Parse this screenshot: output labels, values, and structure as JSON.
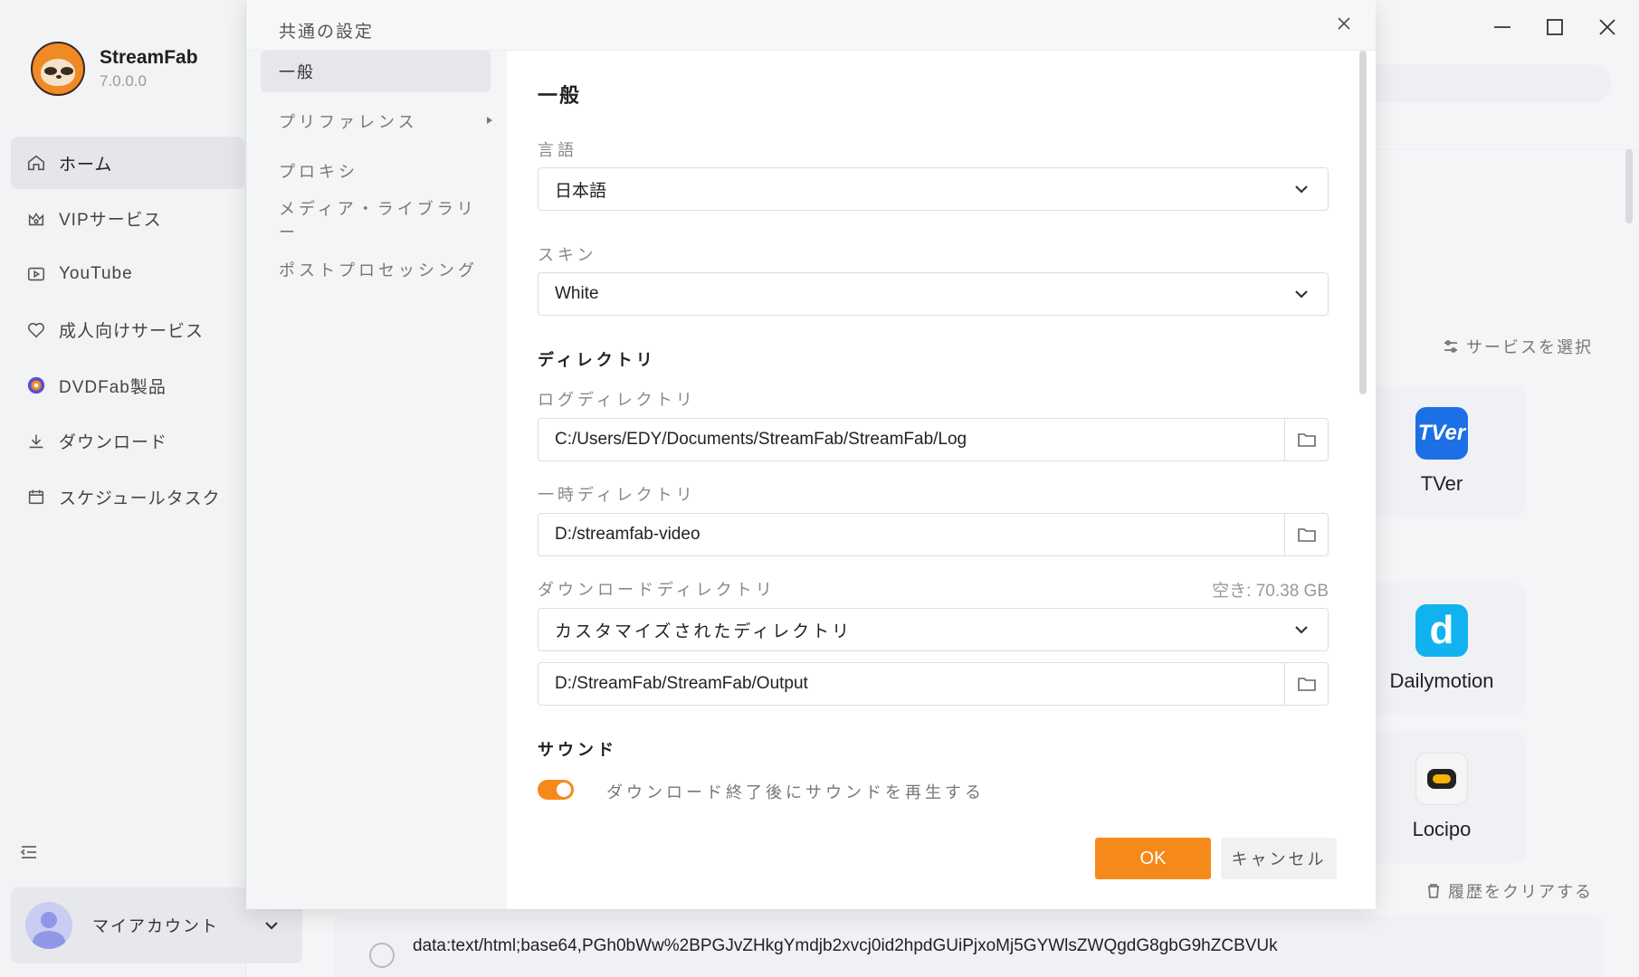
{
  "app": {
    "name": "StreamFab",
    "version": "7.0.0.0"
  },
  "sidebar": {
    "items": [
      {
        "label": "ホーム",
        "icon": "home-icon",
        "active": true
      },
      {
        "label": "VIPサービス",
        "icon": "vip-icon"
      },
      {
        "label": "YouTube",
        "icon": "youtube-icon"
      },
      {
        "label": "成人向けサービス",
        "icon": "heart-icon"
      },
      {
        "label": "DVDFab製品",
        "icon": "dvdfab-icon"
      },
      {
        "label": "ダウンロード",
        "icon": "download-icon"
      },
      {
        "label": "スケジュールタスク",
        "icon": "calendar-icon"
      }
    ],
    "account_label": "マイアカウント"
  },
  "main": {
    "select_service": "サービスを選択",
    "services": [
      {
        "name": "TVer",
        "color": "#1d6fe5"
      },
      {
        "name": "Dailymotion",
        "color": "#10b3f0"
      },
      {
        "name": "Locipo",
        "color": "#f5f5f5"
      }
    ],
    "clear_history": "履歴をクリアする",
    "url_text": "data:text/html;base64,PGh0bWw%2BPGJvZHkgYmdjb2xvcj0id2hpdGUiPjxoMj5GYWlsZWQgdG8gbG9hZCBVUk"
  },
  "dialog": {
    "title": "共通の設定",
    "nav": [
      {
        "label": "一般",
        "active": true
      },
      {
        "label": "プリファレンス",
        "has_submenu": true
      },
      {
        "label": "プロキシ"
      },
      {
        "label": "メディア・ライブラリー"
      },
      {
        "label": "ポストプロセッシング"
      }
    ],
    "section_title": "一般",
    "language": {
      "label": "言語",
      "value": "日本語"
    },
    "skin": {
      "label": "スキン",
      "value": "White"
    },
    "directory_heading": "ディレクトリ",
    "log_dir": {
      "label": "ログディレクトリ",
      "value": "C:/Users/EDY/Documents/StreamFab/StreamFab/Log"
    },
    "temp_dir": {
      "label": "一時ディレクトリ",
      "value": "D:/streamfab-video"
    },
    "download_dir": {
      "label": "ダウンロードディレクトリ",
      "free_space": "空き: 70.38 GB",
      "mode": "カスタマイズされたディレクトリ",
      "value": "D:/StreamFab/StreamFab/Output"
    },
    "sound_heading": "サウンド",
    "sound_toggle": {
      "label": "ダウンロード終了後にサウンドを再生する",
      "on": true
    },
    "ok_label": "OK",
    "cancel_label": "キャンセル",
    "accent_color": "#f58a1a"
  }
}
